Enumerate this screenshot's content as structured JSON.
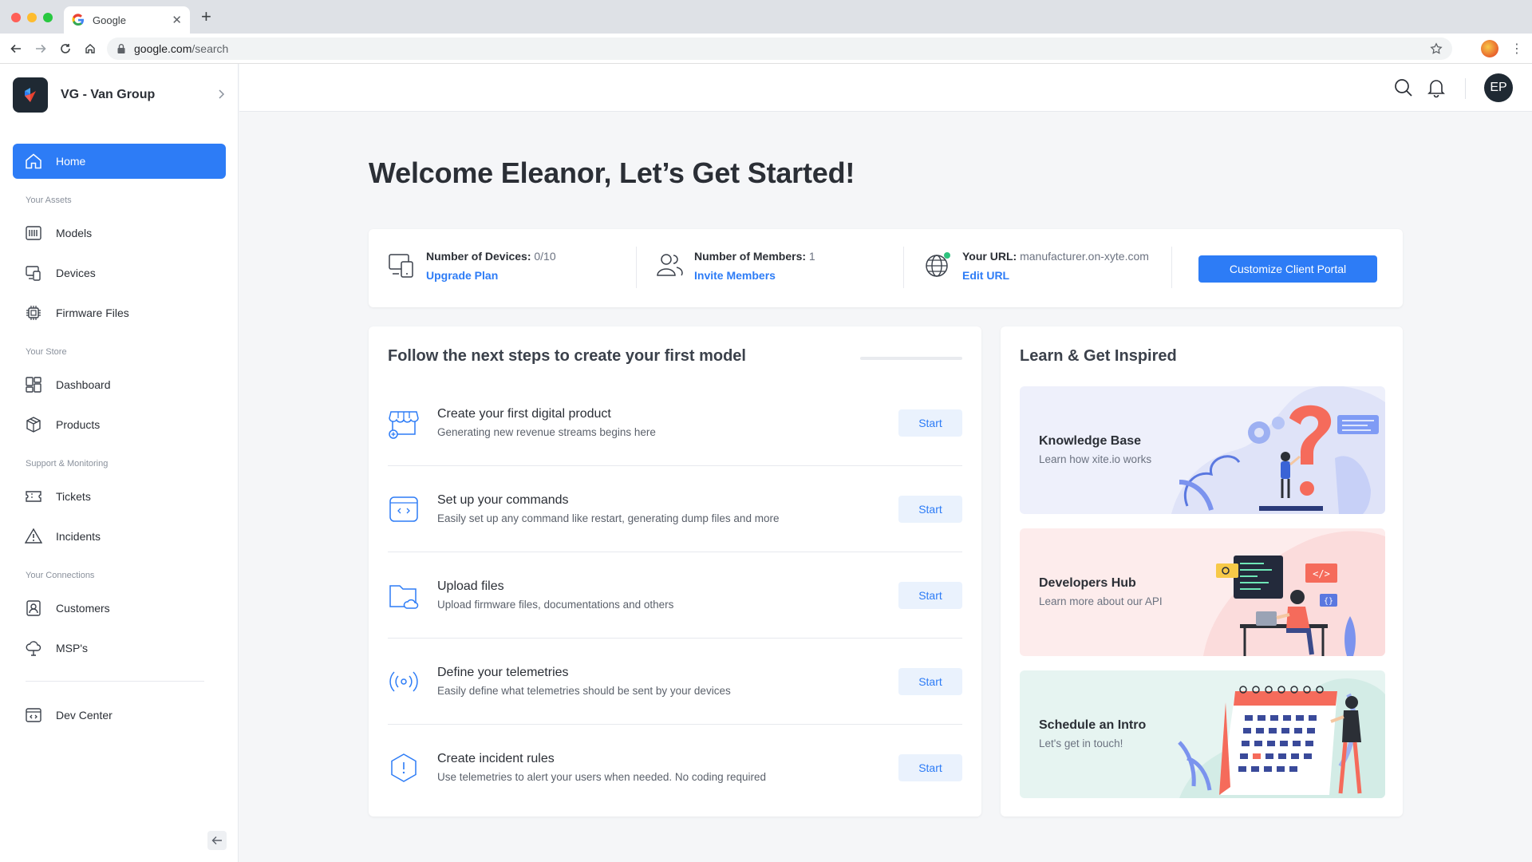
{
  "browser": {
    "tab_title": "Google",
    "url_host": "google.com",
    "url_path": "/search",
    "new_tab_label": "+",
    "close_label": "✕"
  },
  "sidebar": {
    "org_name": "VG - Van Group",
    "items": [
      {
        "label": "Home",
        "icon": "home-icon",
        "active": true
      },
      {
        "label": "Models",
        "icon": "models-icon"
      },
      {
        "label": "Devices",
        "icon": "devices-icon"
      },
      {
        "label": "Firmware Files",
        "icon": "chip-icon"
      },
      {
        "label": "Dashboard",
        "icon": "dashboard-icon"
      },
      {
        "label": "Products",
        "icon": "box-icon"
      },
      {
        "label": "Tickets",
        "icon": "ticket-icon"
      },
      {
        "label": "Incidents",
        "icon": "warning-icon"
      },
      {
        "label": "Customers",
        "icon": "customer-icon"
      },
      {
        "label": "MSP's",
        "icon": "cloud-icon"
      },
      {
        "label": "Dev Center",
        "icon": "code-window-icon"
      }
    ],
    "sections": [
      "Your Assets",
      "Your Store",
      "Support & Monitoring",
      "Your Connections"
    ]
  },
  "header": {
    "avatar_initials": "EP"
  },
  "main": {
    "welcome": "Welcome Eleanor, Let’s Get Started!",
    "stats": {
      "devices_label": "Number of Devices:",
      "devices_value": "0/10",
      "devices_link": "Upgrade Plan",
      "members_label": "Number of Members:",
      "members_value": "1",
      "members_link": "Invite Members",
      "url_label": "Your URL:",
      "url_value": "manufacturer.on-xyte.com",
      "url_link": "Edit URL",
      "cta": "Customize Client Portal"
    },
    "steps_title": "Follow the next steps to create your first model",
    "steps_progress": 0,
    "steps": [
      {
        "title": "Create your first digital product",
        "desc": "Generating new revenue streams begins here",
        "button": "Start"
      },
      {
        "title": "Set up your commands",
        "desc": "Easily set up any command like restart, generating dump files and more",
        "button": "Start"
      },
      {
        "title": "Upload files",
        "desc": "Upload firmware files, documentations and others",
        "button": "Start"
      },
      {
        "title": "Define your telemetries",
        "desc": "Easily define what telemetries should be sent by your devices",
        "button": "Start"
      },
      {
        "title": "Create incident rules",
        "desc": "Use telemetries to alert your users when needed. No coding required",
        "button": "Start"
      }
    ],
    "learn_title": "Learn & Get Inspired",
    "learn": [
      {
        "title": "Knowledge Base",
        "desc": "Learn how xite.io works"
      },
      {
        "title": "Developers Hub",
        "desc": "Learn more about our API"
      },
      {
        "title": "Schedule an Intro",
        "desc": "Let's get in touch!"
      }
    ]
  },
  "colors": {
    "accent": "#2d7cf6",
    "sidebar_bg": "#ffffff",
    "page_bg": "#f5f6f8"
  }
}
